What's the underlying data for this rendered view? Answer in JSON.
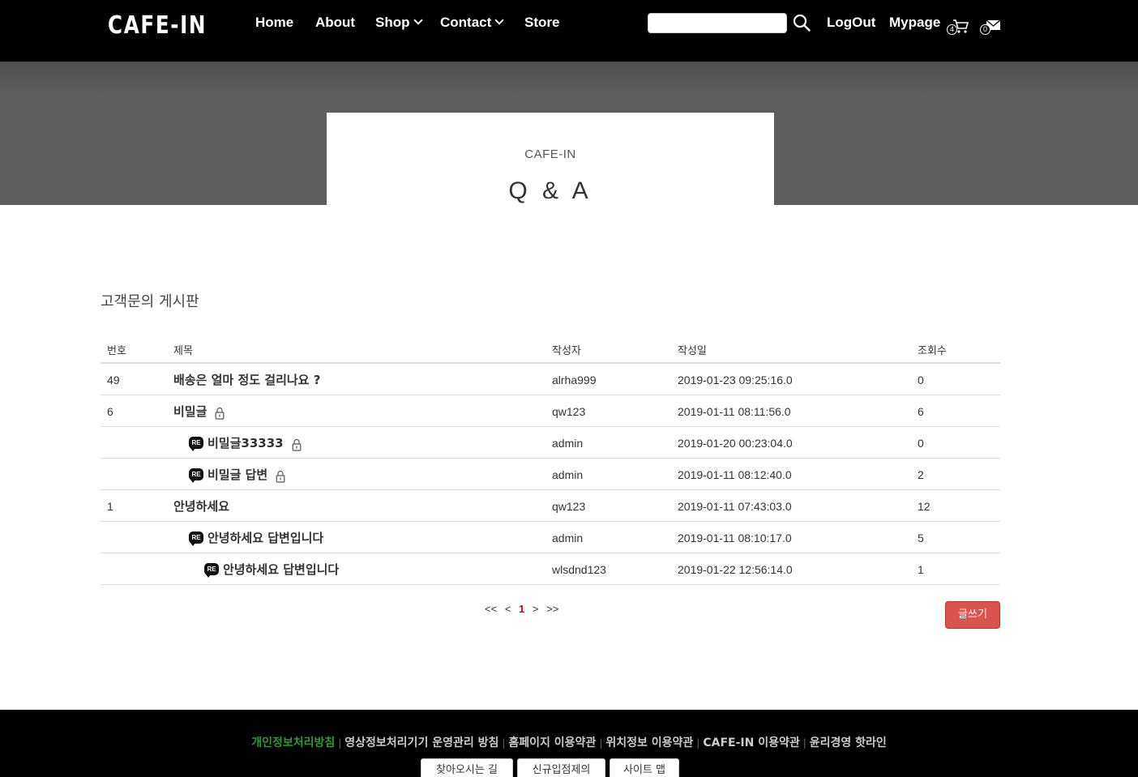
{
  "nav": {
    "logo": "CAFE-IN",
    "menu": [
      "Home",
      "About",
      "Shop",
      "Contact",
      "Store"
    ],
    "search_value": "",
    "logout": "LogOut",
    "mypage": "Mypage",
    "cart_count": "4",
    "mail_count": "0"
  },
  "hero": {
    "subtitle": "CAFE-IN",
    "title": "Q & A"
  },
  "board": {
    "title": "고객문의 게시판",
    "columns": [
      "번호",
      "제목",
      "작성자",
      "작성일",
      "조회수"
    ],
    "rows": [
      {
        "no": "49",
        "subject": "배송은 얼마 정도 걸리나요 ?",
        "writer": "alrha999",
        "date": "2019-01-23 09:25:16.0",
        "views": "0",
        "depth": 0,
        "locked": false
      },
      {
        "no": "6",
        "subject": "비밀글",
        "writer": "qw123",
        "date": "2019-01-11 08:11:56.0",
        "views": "6",
        "depth": 0,
        "locked": true
      },
      {
        "no": "",
        "subject": "비밀글33333",
        "writer": "admin",
        "date": "2019-01-20 00:23:04.0",
        "views": "0",
        "depth": 1,
        "locked": true
      },
      {
        "no": "",
        "subject": "비밀글 답변",
        "writer": "admin",
        "date": "2019-01-11 08:12:40.0",
        "views": "2",
        "depth": 1,
        "locked": true
      },
      {
        "no": "1",
        "subject": "안녕하세요",
        "writer": "qw123",
        "date": "2019-01-11 07:43:03.0",
        "views": "12",
        "depth": 0,
        "locked": false
      },
      {
        "no": "",
        "subject": "안녕하세요 답변입니다",
        "writer": "admin",
        "date": "2019-01-11 08:10:17.0",
        "views": "5",
        "depth": 1,
        "locked": false
      },
      {
        "no": "",
        "subject": "안녕하세요 답변입니다",
        "writer": "wlsdnd123",
        "date": "2019-01-22 12:56:14.0",
        "views": "1",
        "depth": 2,
        "locked": false
      }
    ],
    "re_label": "RE"
  },
  "pager": {
    "first": "<<",
    "prev": "<",
    "current": "1",
    "next": ">",
    "last": ">>"
  },
  "write_button": "글쓰기",
  "footer": {
    "links": [
      "개인정보처리방침",
      "영상정보처리기기 운영관리 방침",
      "홈페이지 이용약관",
      "위치정보 이용약관",
      "CAFE-IN 이용약관",
      "윤리경영 핫라인"
    ],
    "separator": "|",
    "buttons": [
      "찾아오시는 길",
      "신규입점제의",
      "사이트 맵"
    ]
  },
  "colors": {
    "nav_bg": "#000000",
    "hero_bg": "#5e5e5e",
    "write_button": "#d9534f",
    "pager_current": "#dd0000",
    "footer_highlight": "#2e9a2e"
  }
}
